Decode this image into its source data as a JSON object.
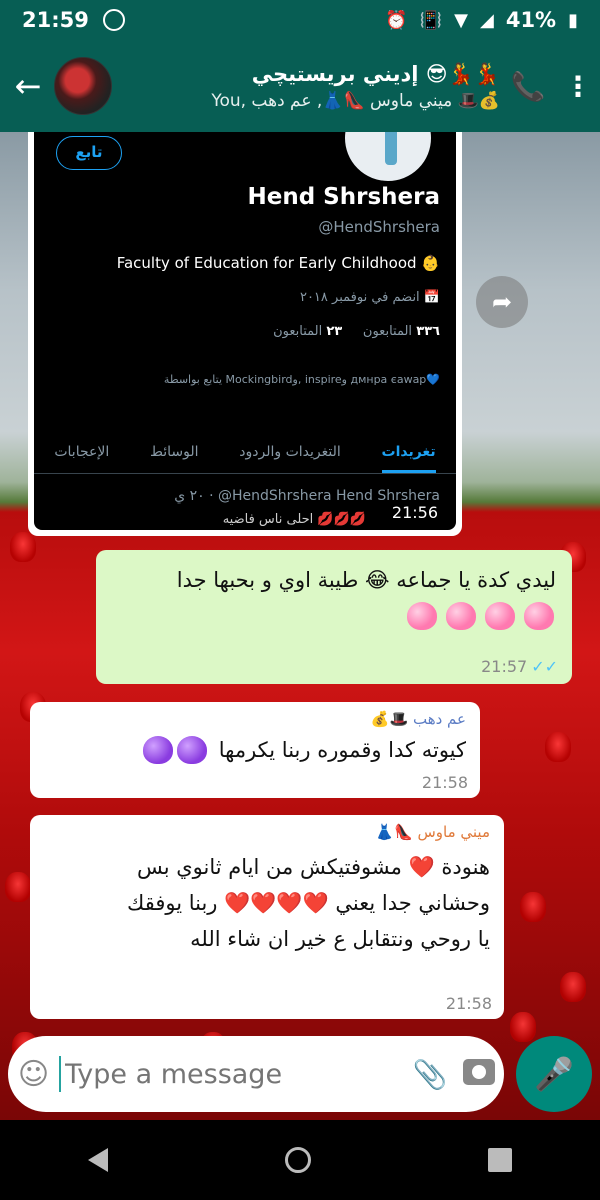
{
  "status_bar": {
    "time": "21:59",
    "battery": "41%",
    "icons": [
      "whatsapp-icon",
      "alarm-icon",
      "vibrate-icon",
      "wifi-icon",
      "signal-icon",
      "battery-icon"
    ]
  },
  "header": {
    "group_name": "إديني بريستيچي 😎💃💃",
    "members": "You, ميني ماوس 👠👗, عم دهب 🎩💰"
  },
  "screenshot": {
    "follow_label": "تابع",
    "name": "Hend Shrshera",
    "handle": "@HendShrshera",
    "bio": "Faculty of Education for Early Childhood 👶",
    "joined": "انضم في نوفمبر ٢٠١٨ 📅",
    "following_count": "٢٣",
    "following_label": "المتابعون",
    "followers_count": "٣٣٦",
    "followers_label": "المتابعون",
    "followed_by": "يتابع بواسطة Mockingbirdو, inspireو дмнра єawap💙",
    "tabs": [
      "تغريدات",
      "التغريدات والردود",
      "الوسائط",
      "الإعجابات"
    ],
    "tweet_header": "٢٠ ي · @HendShrshera Hend Shrshera",
    "tweet_text": "احلى ناس فاضيه 💋💋💋",
    "time": "21:56"
  },
  "messages": [
    {
      "direction": "out",
      "text": "ليدي كدة يا جماعه 😂 طيبة اوي و بحبها جدا",
      "hearts": 4,
      "time": "21:57"
    },
    {
      "direction": "in",
      "sender": "عم دهب 🎩💰",
      "sender_color": "#5b7cc4",
      "text": "كيوته كدا وقموره ربنا يكرمها",
      "hearts": 2,
      "time": "21:58"
    },
    {
      "direction": "in",
      "sender": "ميني ماوس 👠👗",
      "sender_color": "#e07a3a",
      "line1": "هنودة ❤️ مشوفتيكش من ايام ثانوي بس",
      "line2": "وحشاني جدا يعني ❤️❤️❤️❤️ ربنا يوفقك",
      "line3": "يا روحي ونتقابل ع خير ان شاء الله",
      "time": "21:58"
    }
  ],
  "input": {
    "placeholder": "Type a message"
  },
  "colors": {
    "header": "#075E54",
    "outgoing_bubble": "#DCF8C6",
    "mic": "#00897B"
  }
}
